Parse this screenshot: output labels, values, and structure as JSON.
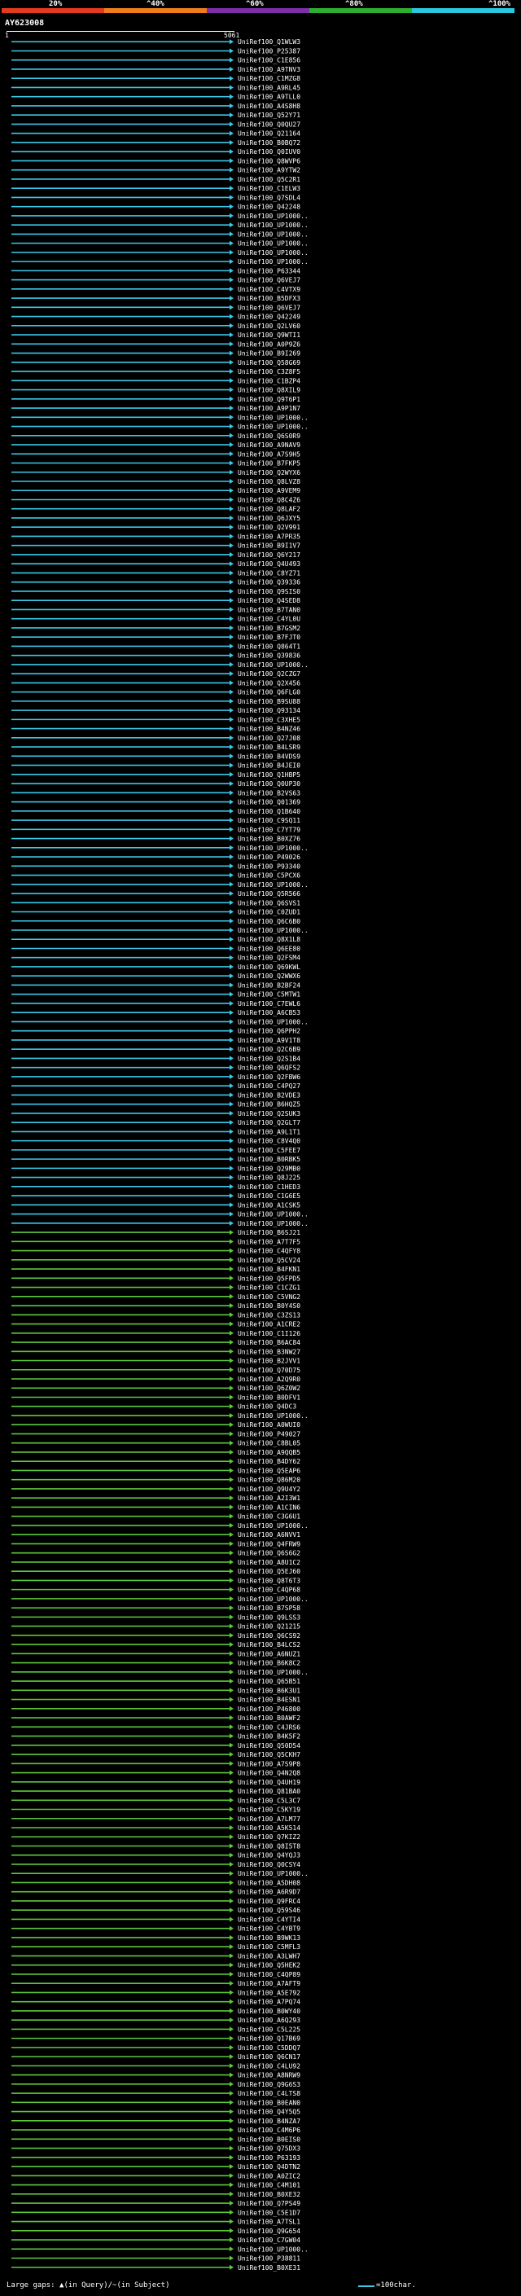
{
  "scale": {
    "marks": [
      "20%",
      "^40%",
      "^60%",
      "^80%",
      "^100%"
    ],
    "colors": [
      "#e53a1e",
      "#ef7d1c",
      "#7c2fa8",
      "#2eae2e",
      "#28c8e0"
    ]
  },
  "query_label": "AY623008",
  "ruler": {
    "start": "1",
    "end": "5061"
  },
  "legend": {
    "text": "Large gaps: ▲(in Query)/~(in Subject)",
    "char_text": "=100char."
  },
  "colors": {
    "cyan": "#3cc8e8",
    "green": "#5dc83c",
    "magenta": "#c040c0",
    "white": "#ffffff"
  },
  "hits": [
    {
      "label": "UniRef100_Q1WLW3",
      "color": "cyan"
    },
    {
      "label": "UniRef100_P25387",
      "color": "cyan"
    },
    {
      "label": "UniRef100_C1E856",
      "color": "cyan"
    },
    {
      "label": "UniRef100_A9TNV3",
      "color": "cyan"
    },
    {
      "label": "UniRef100_C1MZG8",
      "color": "cyan"
    },
    {
      "label": "UniRef100_A9RL45",
      "color": "cyan"
    },
    {
      "label": "UniRef100_A9TLL0",
      "color": "cyan"
    },
    {
      "label": "UniRef100_A4S8H8",
      "color": "cyan"
    },
    {
      "label": "UniRef100_Q52Y71",
      "color": "cyan"
    },
    {
      "label": "UniRef100_Q0QU27",
      "color": "cyan"
    },
    {
      "label": "UniRef100_Q21164",
      "color": "cyan"
    },
    {
      "label": "UniRef100_B0BQ72",
      "color": "cyan"
    },
    {
      "label": "UniRef100_Q0IUV0",
      "color": "cyan"
    },
    {
      "label": "UniRef100_Q8WVP6",
      "color": "cyan"
    },
    {
      "label": "UniRef100_A9YTW2",
      "color": "cyan"
    },
    {
      "label": "UniRef100_Q5C2R1",
      "color": "cyan"
    },
    {
      "label": "UniRef100_C1ELW3",
      "color": "cyan"
    },
    {
      "label": "UniRef100_Q7SDL4",
      "color": "cyan"
    },
    {
      "label": "UniRef100_Q42248",
      "color": "cyan"
    },
    {
      "label": "UniRef100_UP1000..",
      "color": "cyan"
    },
    {
      "label": "UniRef100_UP1000..",
      "color": "cyan"
    },
    {
      "label": "UniRef100_UP1000..",
      "color": "cyan"
    },
    {
      "label": "UniRef100_UP1000..",
      "color": "cyan"
    },
    {
      "label": "UniRef100_UP1000..",
      "color": "cyan"
    },
    {
      "label": "UniRef100_UP1000..",
      "color": "cyan"
    },
    {
      "label": "UniRef100_P63344",
      "color": "cyan"
    },
    {
      "label": "UniRef100_Q6VEJ7",
      "color": "cyan"
    },
    {
      "label": "UniRef100_C4VTX9",
      "color": "cyan"
    },
    {
      "label": "UniRef100_B5DFX3",
      "color": "cyan"
    },
    {
      "label": "UniRef100_Q6VEJ7",
      "color": "cyan"
    },
    {
      "label": "UniRef100_Q42249",
      "color": "cyan"
    },
    {
      "label": "UniRef100_Q2LV60",
      "color": "cyan"
    },
    {
      "label": "UniRef100_Q9WTI1",
      "color": "cyan"
    },
    {
      "label": "UniRef100_A0P9Z6",
      "color": "cyan"
    },
    {
      "label": "UniRef100_B9I269",
      "color": "cyan"
    },
    {
      "label": "UniRef100_Q58G69",
      "color": "cyan"
    },
    {
      "label": "UniRef100_C3Z8F5",
      "color": "cyan"
    },
    {
      "label": "UniRef100_C1BZP4",
      "color": "cyan"
    },
    {
      "label": "UniRef100_Q8XIL9",
      "color": "cyan"
    },
    {
      "label": "UniRef100_Q9T6P1",
      "color": "cyan"
    },
    {
      "label": "UniRef100_A9P1N7",
      "color": "cyan"
    },
    {
      "label": "UniRef100_UP1000..",
      "color": "cyan"
    },
    {
      "label": "UniRef100_UP1000..",
      "color": "cyan"
    },
    {
      "label": "UniRef100_Q6S0R9",
      "color": "cyan"
    },
    {
      "label": "UniRef100_A9NAV9",
      "color": "cyan"
    },
    {
      "label": "UniRef100_A7S9H5",
      "color": "cyan"
    },
    {
      "label": "UniRef100_B7FKP5",
      "color": "cyan"
    },
    {
      "label": "UniRef100_Q2WYX6",
      "color": "cyan"
    },
    {
      "label": "UniRef100_Q8LVZ8",
      "color": "cyan"
    },
    {
      "label": "UniRef100_A9VEM9",
      "color": "cyan"
    },
    {
      "label": "UniRef100_Q8C4Z6",
      "color": "cyan"
    },
    {
      "label": "UniRef100_Q8LAF2",
      "color": "cyan"
    },
    {
      "label": "UniRef100_Q6JXY5",
      "color": "cyan"
    },
    {
      "label": "UniRef100_Q2V991",
      "color": "cyan"
    },
    {
      "label": "UniRef100_A7PR35",
      "color": "cyan"
    },
    {
      "label": "UniRef100_B9I1V7",
      "color": "cyan"
    },
    {
      "label": "UniRef100_Q6Y217",
      "color": "cyan"
    },
    {
      "label": "UniRef100_Q4U493",
      "color": "cyan"
    },
    {
      "label": "UniRef100_C8YZ71",
      "color": "cyan"
    },
    {
      "label": "UniRef100_Q39336",
      "color": "cyan"
    },
    {
      "label": "UniRef100_Q9SIS0",
      "color": "cyan"
    },
    {
      "label": "UniRef100_Q4SED8",
      "color": "cyan"
    },
    {
      "label": "UniRef100_B7TAN0",
      "color": "cyan"
    },
    {
      "label": "UniRef100_C4YL0U",
      "color": "cyan"
    },
    {
      "label": "UniRef100_B7GSM2",
      "color": "cyan"
    },
    {
      "label": "UniRef100_B7FJT0",
      "color": "cyan"
    },
    {
      "label": "UniRef100_Q864T1",
      "color": "cyan"
    },
    {
      "label": "UniRef100_Q39836",
      "color": "cyan"
    },
    {
      "label": "UniRef100_UP1000..",
      "color": "cyan"
    },
    {
      "label": "UniRef100_Q2CZG7",
      "color": "cyan"
    },
    {
      "label": "UniRef100_Q2X456",
      "color": "cyan"
    },
    {
      "label": "UniRef100_Q6FLG0",
      "color": "cyan"
    },
    {
      "label": "UniRef100_B9SU88",
      "color": "cyan"
    },
    {
      "label": "UniRef100_Q93134",
      "color": "cyan"
    },
    {
      "label": "UniRef100_C3XHE5",
      "color": "cyan"
    },
    {
      "label": "UniRef100_B4NZ46",
      "color": "cyan"
    },
    {
      "label": "UniRef100_Q27J08",
      "color": "cyan"
    },
    {
      "label": "UniRef100_B4LSR9",
      "color": "cyan"
    },
    {
      "label": "UniRef100_B4VDS9",
      "color": "cyan"
    },
    {
      "label": "UniRef100_B4JEI0",
      "color": "cyan"
    },
    {
      "label": "UniRef100_Q1HBP5",
      "color": "cyan"
    },
    {
      "label": "UniRef100_Q0UP30",
      "color": "cyan"
    },
    {
      "label": "UniRef100_B2VS63",
      "color": "cyan"
    },
    {
      "label": "UniRef100_Q01369",
      "color": "cyan"
    },
    {
      "label": "UniRef100_Q1B640",
      "color": "cyan"
    },
    {
      "label": "UniRef100_C9SQ11",
      "color": "cyan"
    },
    {
      "label": "UniRef100_C7YT79",
      "color": "cyan"
    },
    {
      "label": "UniRef100_B0XZ76",
      "color": "cyan"
    },
    {
      "label": "UniRef100_UP1000..",
      "color": "cyan"
    },
    {
      "label": "UniRef100_P49026",
      "color": "cyan"
    },
    {
      "label": "UniRef100_P93340",
      "color": "cyan"
    },
    {
      "label": "UniRef100_C5PCX6",
      "color": "cyan"
    },
    {
      "label": "UniRef100_UP1000..",
      "color": "cyan"
    },
    {
      "label": "UniRef100_Q5R566",
      "color": "cyan"
    },
    {
      "label": "UniRef100_Q6SVS1",
      "color": "cyan"
    },
    {
      "label": "UniRef100_C0ZUD1",
      "color": "cyan"
    },
    {
      "label": "UniRef100_Q6C6B0",
      "color": "cyan"
    },
    {
      "label": "UniRef100_UP1000..",
      "color": "cyan"
    },
    {
      "label": "UniRef100_Q8X1L8",
      "color": "cyan"
    },
    {
      "label": "UniRef100_Q6EE80",
      "color": "cyan"
    },
    {
      "label": "UniRef100_Q2FSM4",
      "color": "cyan"
    },
    {
      "label": "UniRef100_Q69KWL",
      "color": "cyan"
    },
    {
      "label": "UniRef100_Q2WWX6",
      "color": "cyan"
    },
    {
      "label": "UniRef100_B2BF24",
      "color": "cyan"
    },
    {
      "label": "UniRef100_C5MTW1",
      "color": "cyan"
    },
    {
      "label": "UniRef100_C7EWL6",
      "color": "cyan"
    },
    {
      "label": "UniRef100_A6CB53",
      "color": "cyan"
    },
    {
      "label": "UniRef100_UP1000..",
      "color": "cyan"
    },
    {
      "label": "UniRef100_Q6PPH2",
      "color": "cyan"
    },
    {
      "label": "UniRef100_A9V1T8",
      "color": "cyan"
    },
    {
      "label": "UniRef100_Q2C6B9",
      "color": "cyan"
    },
    {
      "label": "UniRef100_Q2S1B4",
      "color": "cyan"
    },
    {
      "label": "UniRef100_Q6QFS2",
      "color": "cyan"
    },
    {
      "label": "UniRef100_Q2FBW6",
      "color": "cyan"
    },
    {
      "label": "UniRef100_C4PQ27",
      "color": "cyan"
    },
    {
      "label": "UniRef100_B2VDE3",
      "color": "cyan"
    },
    {
      "label": "UniRef100_B6HQZ5",
      "color": "cyan"
    },
    {
      "label": "UniRef100_Q2SUK3",
      "color": "cyan"
    },
    {
      "label": "UniRef100_Q2GLT7",
      "color": "cyan"
    },
    {
      "label": "UniRef100_A9L1T1",
      "color": "cyan"
    },
    {
      "label": "UniRef100_C8V4Q0",
      "color": "cyan"
    },
    {
      "label": "UniRef100_C5FEE7",
      "color": "cyan"
    },
    {
      "label": "UniRef100_B0RBK5",
      "color": "cyan"
    },
    {
      "label": "UniRef100_Q29MB0",
      "color": "cyan"
    },
    {
      "label": "UniRef100_Q8J225",
      "color": "cyan"
    },
    {
      "label": "UniRef100_C1HED3",
      "color": "cyan"
    },
    {
      "label": "UniRef100_C1G6E5",
      "color": "cyan"
    },
    {
      "label": "UniRef100_A1CSK5",
      "color": "cyan"
    },
    {
      "label": "UniRef100_UP1000..",
      "color": "cyan"
    },
    {
      "label": "UniRef100_UP1000..",
      "color": "cyan"
    },
    {
      "label": "UniRef100_B6SJ21",
      "color": "green"
    },
    {
      "label": "UniRef100_A7T7F5",
      "color": "green"
    },
    {
      "label": "UniRef100_C4QFY8",
      "color": "green"
    },
    {
      "label": "UniRef100_Q5CV24",
      "color": "green"
    },
    {
      "label": "UniRef100_B4FKN1",
      "color": "green"
    },
    {
      "label": "UniRef100_Q5FPD5",
      "color": "green"
    },
    {
      "label": "UniRef100_C1CZG1",
      "color": "green"
    },
    {
      "label": "UniRef100_C5VNG2",
      "color": "green"
    },
    {
      "label": "UniRef100_B0Y4S0",
      "color": "green"
    },
    {
      "label": "UniRef100_C3ZS13",
      "color": "green"
    },
    {
      "label": "UniRef100_A1CRE2",
      "color": "green"
    },
    {
      "label": "UniRef100_C1I126",
      "color": "green"
    },
    {
      "label": "UniRef100_B6AC84",
      "color": "green"
    },
    {
      "label": "UniRef100_B3NW27",
      "color": "green"
    },
    {
      "label": "UniRef100_B2JVV1",
      "color": "green"
    },
    {
      "label": "UniRef100_Q70D75",
      "color": "green"
    },
    {
      "label": "UniRef100_A2Q9R0",
      "color": "green"
    },
    {
      "label": "UniRef100_Q6Z0W2",
      "color": "green"
    },
    {
      "label": "UniRef100_B0DFV1",
      "color": "green"
    },
    {
      "label": "UniRef100_Q4DC3",
      "color": "green"
    },
    {
      "label": "UniRef100_UP1000..",
      "color": "green"
    },
    {
      "label": "UniRef100_A0WUI0",
      "color": "green"
    },
    {
      "label": "UniRef100_P49027",
      "color": "green"
    },
    {
      "label": "UniRef100_C8BL05",
      "color": "green"
    },
    {
      "label": "UniRef100_A9QQB5",
      "color": "green"
    },
    {
      "label": "UniRef100_B4DY62",
      "color": "green"
    },
    {
      "label": "UniRef100_Q5EAP6",
      "color": "green"
    },
    {
      "label": "UniRef100_Q86M20",
      "color": "green"
    },
    {
      "label": "UniRef100_Q9U4Y2",
      "color": "green"
    },
    {
      "label": "UniRef100_A2I3W1",
      "color": "green"
    },
    {
      "label": "UniRef100_A1CIN6",
      "color": "green"
    },
    {
      "label": "UniRef100_C3G6U1",
      "color": "green"
    },
    {
      "label": "UniRef100_UP1000..",
      "color": "green"
    },
    {
      "label": "UniRef100_A6NVV1",
      "color": "green"
    },
    {
      "label": "UniRef100_Q4FRW9",
      "color": "green"
    },
    {
      "label": "UniRef100_Q6S6G2",
      "color": "green"
    },
    {
      "label": "UniRef100_A8U1C2",
      "color": "green"
    },
    {
      "label": "UniRef100_Q5EJ60",
      "color": "green"
    },
    {
      "label": "UniRef100_Q8T6T3",
      "color": "green"
    },
    {
      "label": "UniRef100_C4QP68",
      "color": "green"
    },
    {
      "label": "UniRef100_UP1000..",
      "color": "green"
    },
    {
      "label": "UniRef100_B7SP58",
      "color": "green"
    },
    {
      "label": "UniRef100_Q9LSS3",
      "color": "green"
    },
    {
      "label": "UniRef100_Q21215",
      "color": "green"
    },
    {
      "label": "UniRef100_Q6CS92",
      "color": "green"
    },
    {
      "label": "UniRef100_B4LCS2",
      "color": "green"
    },
    {
      "label": "UniRef100_A6NUZ1",
      "color": "green"
    },
    {
      "label": "UniRef100_B6K8C2",
      "color": "green"
    },
    {
      "label": "UniRef100_UP1000..",
      "color": "green"
    },
    {
      "label": "UniRef100_Q65B51",
      "color": "green"
    },
    {
      "label": "UniRef100_B6K3U1",
      "color": "green"
    },
    {
      "label": "UniRef100_B4ESN1",
      "color": "green"
    },
    {
      "label": "UniRef100_P46800",
      "color": "green"
    },
    {
      "label": "UniRef100_B0AWF2",
      "color": "green"
    },
    {
      "label": "UniRef100_C4JRS6",
      "color": "green"
    },
    {
      "label": "UniRef100_B4K5F2",
      "color": "green"
    },
    {
      "label": "UniRef100_Q50D54",
      "color": "green"
    },
    {
      "label": "UniRef100_Q5CKH7",
      "color": "green"
    },
    {
      "label": "UniRef100_A7S9P8",
      "color": "green"
    },
    {
      "label": "UniRef100_Q4N2Q8",
      "color": "green"
    },
    {
      "label": "UniRef100_Q4UH19",
      "color": "green"
    },
    {
      "label": "UniRef100_Q81BA0",
      "color": "green"
    },
    {
      "label": "UniRef100_C5L3C7",
      "color": "green"
    },
    {
      "label": "UniRef100_C5KY19",
      "color": "green"
    },
    {
      "label": "UniRef100_A7LM77",
      "color": "green"
    },
    {
      "label": "UniRef100_A5K514",
      "color": "green"
    },
    {
      "label": "UniRef100_Q7KIZ2",
      "color": "green"
    },
    {
      "label": "UniRef100_Q8I5T8",
      "color": "green"
    },
    {
      "label": "UniRef100_Q4YQJ3",
      "color": "green"
    },
    {
      "label": "UniRef100_Q0CSY4",
      "color": "green"
    },
    {
      "label": "UniRef100_UP1000..",
      "color": "green"
    },
    {
      "label": "UniRef100_A5DH08",
      "color": "green"
    },
    {
      "label": "UniRef100_A6R9D7",
      "color": "green"
    },
    {
      "label": "UniRef100_Q9FRC4",
      "color": "green"
    },
    {
      "label": "UniRef100_Q59S46",
      "color": "green"
    },
    {
      "label": "UniRef100_C4YTI4",
      "color": "green"
    },
    {
      "label": "UniRef100_C4YBT9",
      "color": "green"
    },
    {
      "label": "UniRef100_B9WK13",
      "color": "green"
    },
    {
      "label": "UniRef100_C5MFL3",
      "color": "green"
    },
    {
      "label": "UniRef100_A3LWH7",
      "color": "green"
    },
    {
      "label": "UniRef100_Q5HEK2",
      "color": "green"
    },
    {
      "label": "UniRef100_C4QP89",
      "color": "green"
    },
    {
      "label": "UniRef100_A7AFT9",
      "color": "green"
    },
    {
      "label": "UniRef100_A5E792",
      "color": "green"
    },
    {
      "label": "UniRef100_A7PQ74",
      "color": "green"
    },
    {
      "label": "UniRef100_B0WY40",
      "color": "green"
    },
    {
      "label": "UniRef100_A6Q293",
      "color": "green"
    },
    {
      "label": "UniRef100_C5L225",
      "color": "green"
    },
    {
      "label": "UniRef100_Q17B69",
      "color": "green"
    },
    {
      "label": "UniRef100_C5DDQ7",
      "color": "green"
    },
    {
      "label": "UniRef100_Q6CN17",
      "color": "green"
    },
    {
      "label": "UniRef100_C4LU92",
      "color": "green"
    },
    {
      "label": "UniRef100_A8NRW9",
      "color": "green"
    },
    {
      "label": "UniRef100_Q9G6S3",
      "color": "green"
    },
    {
      "label": "UniRef100_C4LTS8",
      "color": "green"
    },
    {
      "label": "UniRef100_B0EAN0",
      "color": "green"
    },
    {
      "label": "UniRef100_Q4Y5Q5",
      "color": "green"
    },
    {
      "label": "UniRef100_B4NZA7",
      "color": "green"
    },
    {
      "label": "UniRef100_C4M6P6",
      "color": "green"
    },
    {
      "label": "UniRef100_B0EIS0",
      "color": "green"
    },
    {
      "label": "UniRef100_Q75DX3",
      "color": "green"
    },
    {
      "label": "UniRef100_P63193",
      "color": "green"
    },
    {
      "label": "UniRef100_Q4DTN2",
      "color": "green"
    },
    {
      "label": "UniRef100_A0ZIC2",
      "color": "green"
    },
    {
      "label": "UniRef100_C4M101",
      "color": "green"
    },
    {
      "label": "UniRef100_B0XE32",
      "color": "green"
    },
    {
      "label": "UniRef100_Q7PS49",
      "color": "green"
    },
    {
      "label": "UniRef100_C5E1D7",
      "color": "green"
    },
    {
      "label": "UniRef100_A7TSL1",
      "color": "green"
    },
    {
      "label": "UniRef100_Q9G654",
      "color": "green"
    },
    {
      "label": "UniRef100_C7GW04",
      "color": "green"
    },
    {
      "label": "UniRef100_UP1000..",
      "color": "green"
    },
    {
      "label": "UniRef100_P38811",
      "color": "green"
    },
    {
      "label": "UniRef100_B0XE31",
      "color": "green"
    }
  ]
}
